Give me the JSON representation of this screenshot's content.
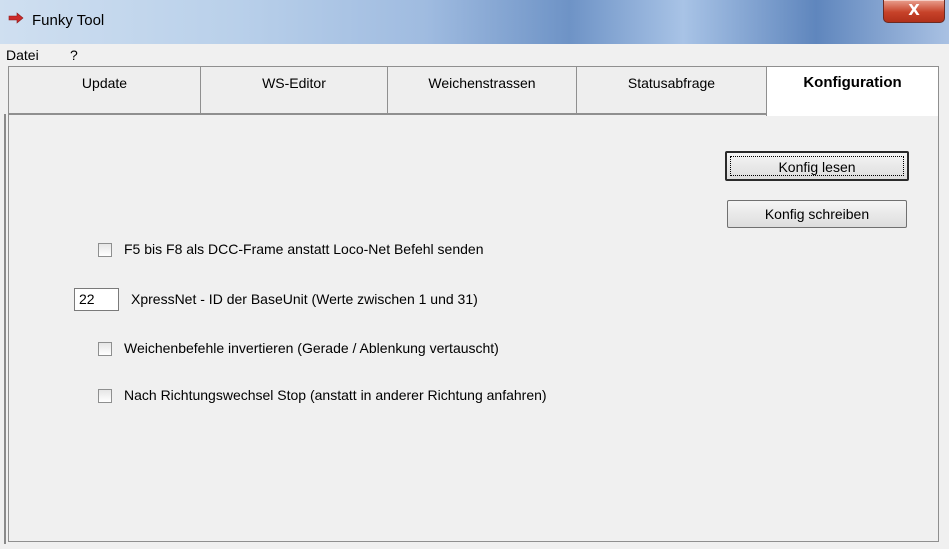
{
  "window": {
    "title": "Funky Tool",
    "close_label": "X"
  },
  "menu": {
    "items": [
      "Datei",
      "?"
    ]
  },
  "tabs": [
    {
      "label": "Update",
      "active": false
    },
    {
      "label": "WS-Editor",
      "active": false
    },
    {
      "label": "Weichenstrassen",
      "active": false
    },
    {
      "label": "Statusabfrage",
      "active": false
    },
    {
      "label": "Konfiguration",
      "active": true
    }
  ],
  "config": {
    "read_button": "Konfig lesen",
    "write_button": "Konfig schreiben",
    "dcc_frame_option": {
      "label": "F5 bis F8 als DCC-Frame anstatt Loco-Net Befehl senden",
      "checked": false
    },
    "xpressnet_id": {
      "value": "22",
      "label": "XpressNet - ID der BaseUnit (Werte zwischen 1 und 31)"
    },
    "invert_switch_option": {
      "label": "Weichenbefehle invertieren (Gerade / Ablenkung vertauscht)",
      "checked": false
    },
    "stop_on_direction_option": {
      "label": "Nach Richtungswechsel Stop (anstatt in anderer Richtung anfahren)",
      "checked": false
    }
  },
  "colors": {
    "app_icon": "#cc2a2a",
    "close_button": "#c7432a"
  }
}
